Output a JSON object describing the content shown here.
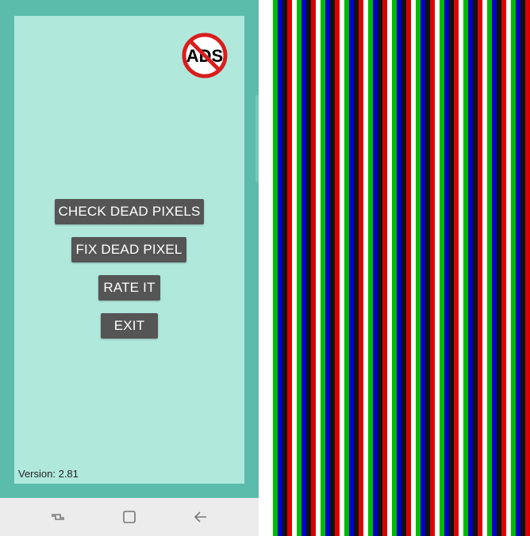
{
  "app": {
    "buttons": {
      "check_dead_pixels": "CHECK DEAD PIXELS",
      "fix_dead_pixel": "FIX DEAD PIXEL",
      "rate_it": "RATE IT",
      "exit": "EXIT"
    },
    "version": "Version: 2.81",
    "no_ads_badge": {
      "text": "ADS",
      "icon": "no-ads-icon"
    },
    "colors": {
      "frame": "#5bbcac",
      "panel": "#b0e8dc",
      "button": "#555555",
      "badge_ring": "#d91e1e"
    }
  },
  "navbar": {
    "items": [
      {
        "icon": "recents-icon"
      },
      {
        "icon": "home-icon"
      },
      {
        "icon": "back-icon"
      }
    ]
  },
  "test_pattern": {
    "sequence": [
      "#ffffff",
      "#00bb00",
      "#0000cc",
      "#111111",
      "#dd0000"
    ],
    "colors": {
      "white": "#ffffff",
      "green": "#00bb00",
      "blue": "#0000cc",
      "black": "#111111",
      "red": "#dd0000"
    }
  }
}
